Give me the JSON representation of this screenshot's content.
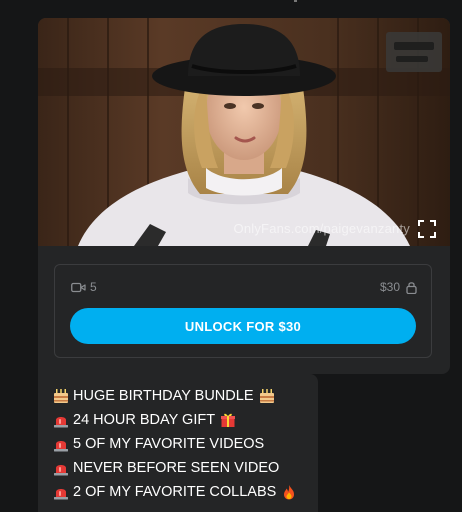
{
  "post": {
    "watermark": "OnlyFans.com/paigevanzanty",
    "media_count": "5",
    "price": "$30",
    "unlock_label": "UNLOCK FOR $30"
  },
  "message": {
    "lines": [
      {
        "text": "HUGE BIRTHDAY BUNDLE",
        "lead_icon": "birthday-cake-icon",
        "trail_icon": "birthday-cake-icon"
      },
      {
        "text": "24 HOUR BDAY GIFT",
        "lead_icon": "siren-icon",
        "trail_icon": "gift-icon"
      },
      {
        "text": "5 OF MY FAVORITE VIDEOS",
        "lead_icon": "siren-icon"
      },
      {
        "text": "NEVER BEFORE SEEN VIDEO",
        "lead_icon": "siren-icon"
      },
      {
        "text": "2 OF MY FAVORITE COLLABS",
        "lead_icon": "siren-icon",
        "trail_icon": "fire-icon"
      }
    ]
  },
  "colors": {
    "background": "#151617",
    "bubble": "#242526",
    "accent": "#00aff0",
    "muted_text": "#8a8d91"
  }
}
